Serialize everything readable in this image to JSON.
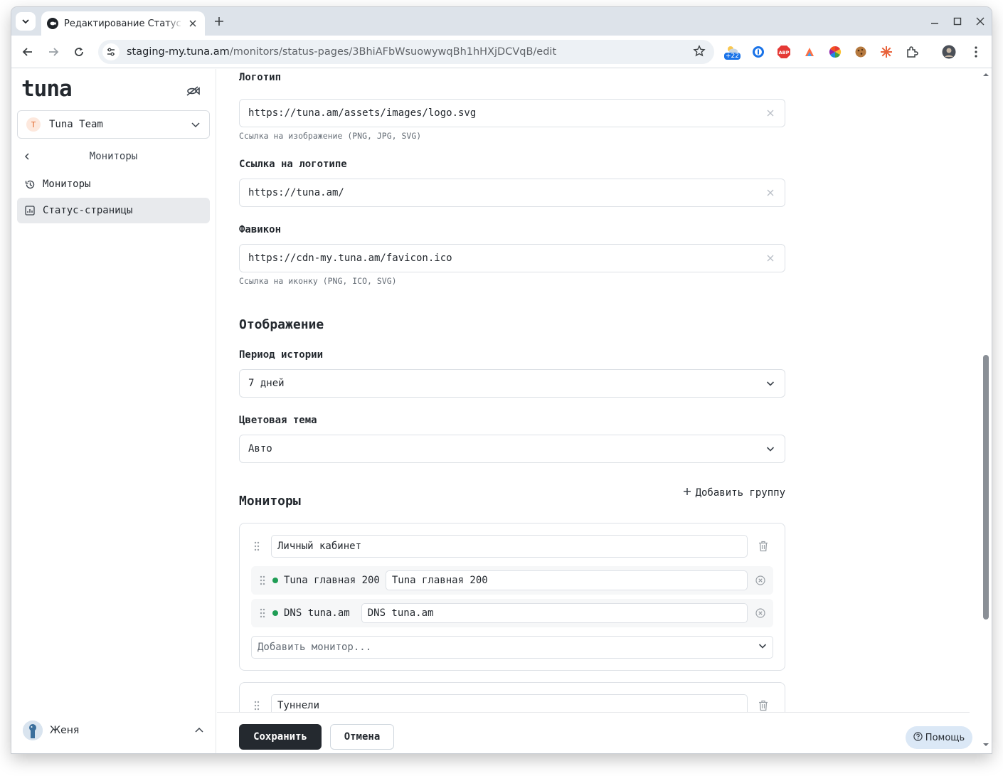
{
  "browser": {
    "tab_title": "Редактирование Статус ра",
    "url_host": "staging-my.tuna.am",
    "url_path": "/monitors/status-pages/3BhiAFbWsuowywqBh1hHXjDCVqB/edit",
    "notification_badge": "+22"
  },
  "sidebar": {
    "logo": "tuna",
    "team": {
      "initial": "T",
      "name": "Tuna Team"
    },
    "back_label": "Мониторы",
    "items": [
      {
        "label": "Мониторы",
        "icon": "history-icon",
        "active": false
      },
      {
        "label": "Статус-страницы",
        "icon": "chart-icon",
        "active": true
      }
    ],
    "user": {
      "name": "Женя"
    }
  },
  "form": {
    "logo": {
      "label": "Логотип",
      "value": "https://tuna.am/assets/images/logo.svg",
      "hint": "Ссылка на изображение (PNG, JPG, SVG)"
    },
    "logo_link": {
      "label": "Ссылка на логотипе",
      "value": "https://tuna.am/"
    },
    "favicon": {
      "label": "Фавикон",
      "value": "https://cdn-my.tuna.am/favicon.ico",
      "hint": "Ссылка на иконку (PNG, ICO, SVG)"
    },
    "display": {
      "title": "Отображение",
      "history_label": "Период истории",
      "history_value": "7 дней",
      "theme_label": "Цветовая тема",
      "theme_value": "Авто"
    },
    "monitors": {
      "title": "Мониторы",
      "add_group": "Добавить группу",
      "groups": [
        {
          "name": "Личный кабинет",
          "monitors": [
            {
              "name": "Tuna главная 200",
              "display": "Tuna главная 200",
              "status_color": "#1f9d55"
            },
            {
              "name": "DNS tuna.am",
              "display": "DNS tuna.am",
              "status_color": "#1f9d55"
            }
          ],
          "add_monitor_placeholder": "Добавить монитор..."
        },
        {
          "name": "Туннели"
        }
      ]
    }
  },
  "footer": {
    "save": "Сохранить",
    "cancel": "Отмена",
    "help": "Помощь"
  }
}
